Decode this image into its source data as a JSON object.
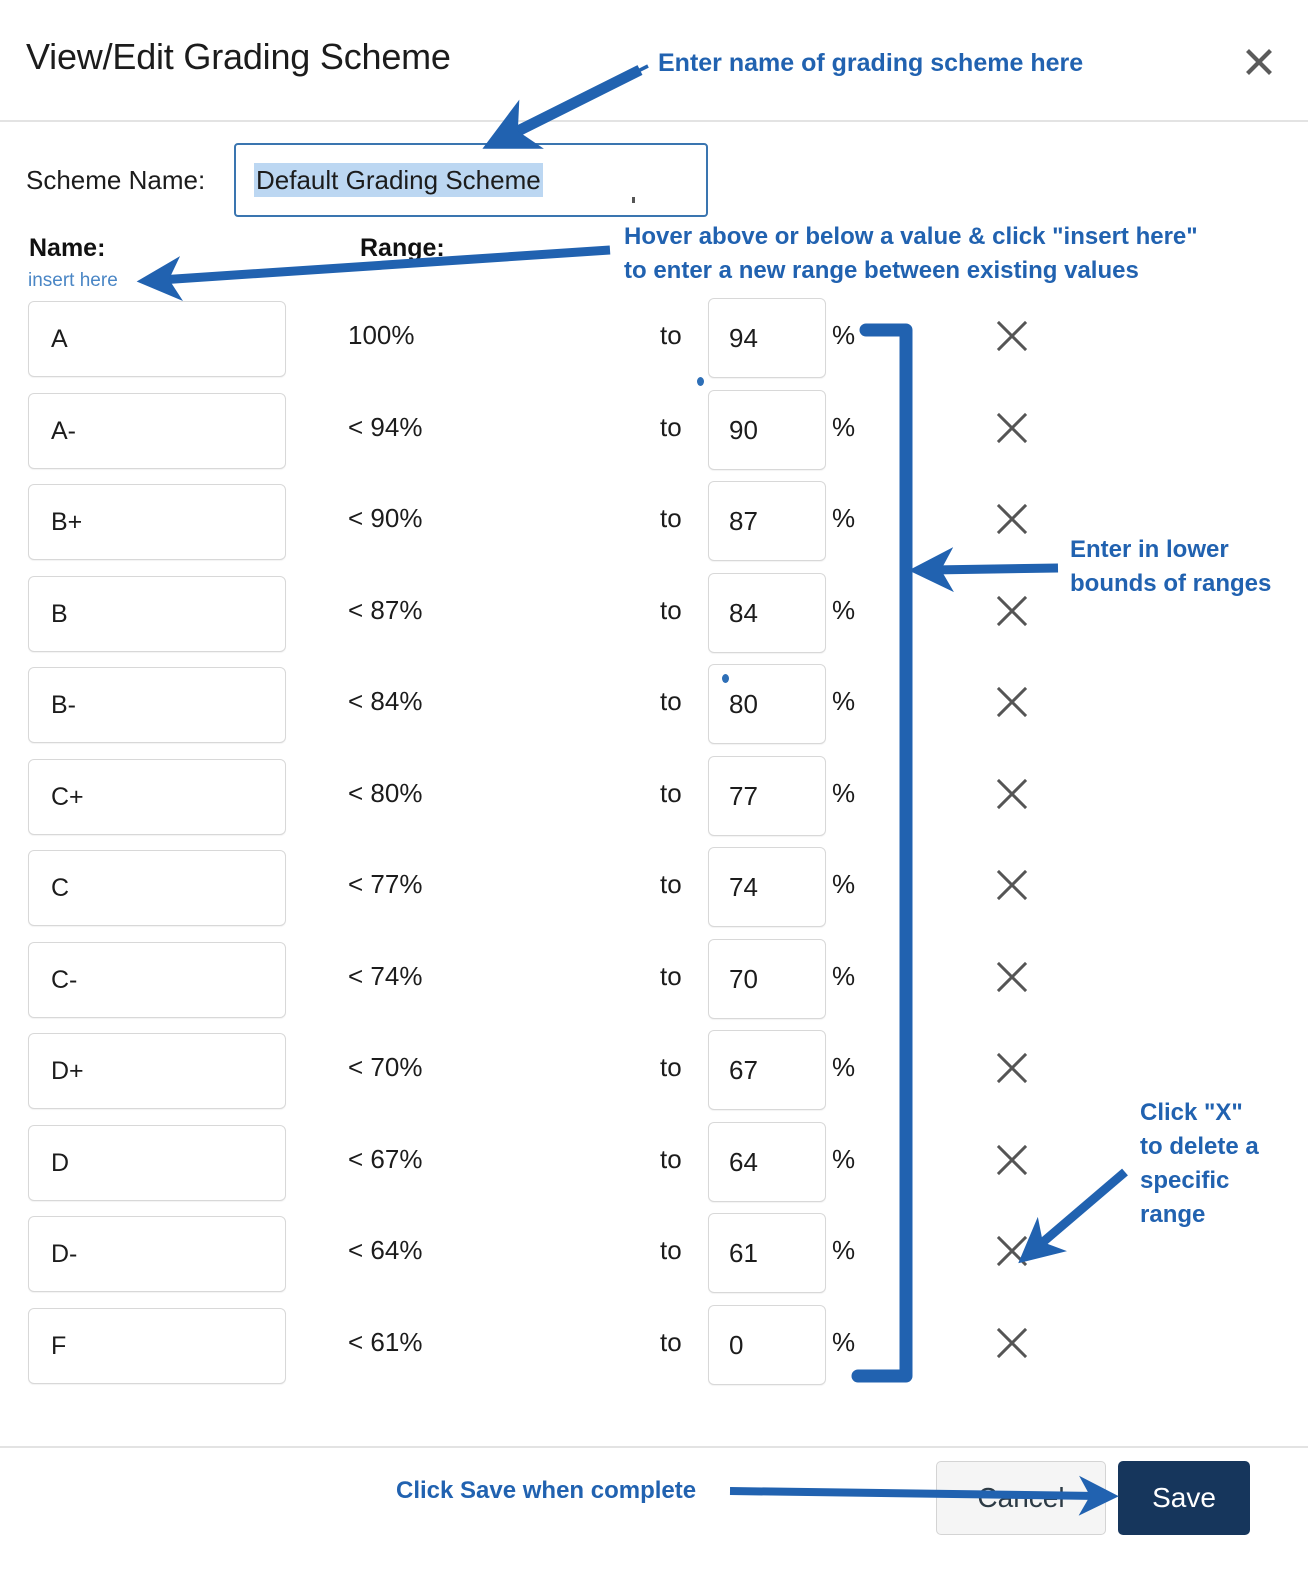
{
  "dialog": {
    "title": "View/Edit Grading Scheme",
    "close_icon": "close-icon"
  },
  "scheme_name": {
    "label": "Scheme Name:",
    "value": "Default Grading Scheme",
    "placeholder": "Scheme name"
  },
  "columns": {
    "name_header": "Name:",
    "range_header": "Range:",
    "insert_here": "insert here",
    "to_label": "to",
    "percent_sign": "%"
  },
  "rows": [
    {
      "name": "A",
      "upper": "100%",
      "to": "to",
      "lower": "94",
      "pct": "%",
      "delete_icon": "close-icon"
    },
    {
      "name": "A-",
      "upper": "< 94%",
      "to": "to",
      "lower": "90",
      "pct": "%",
      "delete_icon": "close-icon"
    },
    {
      "name": "B+",
      "upper": "< 90%",
      "to": "to",
      "lower": "87",
      "pct": "%",
      "delete_icon": "close-icon"
    },
    {
      "name": "B",
      "upper": "< 87%",
      "to": "to",
      "lower": "84",
      "pct": "%",
      "delete_icon": "close-icon"
    },
    {
      "name": "B-",
      "upper": "< 84%",
      "to": "to",
      "lower": "80",
      "pct": "%",
      "delete_icon": "close-icon"
    },
    {
      "name": "C+",
      "upper": "< 80%",
      "to": "to",
      "lower": "77",
      "pct": "%",
      "delete_icon": "close-icon"
    },
    {
      "name": "C",
      "upper": "< 77%",
      "to": "to",
      "lower": "74",
      "pct": "%",
      "delete_icon": "close-icon"
    },
    {
      "name": "C-",
      "upper": "< 74%",
      "to": "to",
      "lower": "70",
      "pct": "%",
      "delete_icon": "close-icon"
    },
    {
      "name": "D+",
      "upper": "< 70%",
      "to": "to",
      "lower": "67",
      "pct": "%",
      "delete_icon": "close-icon"
    },
    {
      "name": "D",
      "upper": "< 67%",
      "to": "to",
      "lower": "64",
      "pct": "%",
      "delete_icon": "close-icon"
    },
    {
      "name": "D-",
      "upper": "< 64%",
      "to": "to",
      "lower": "61",
      "pct": "%",
      "delete_icon": "close-icon"
    },
    {
      "name": "F",
      "upper": "< 61%",
      "to": "to",
      "lower": "0",
      "pct": "%",
      "delete_icon": "close-icon"
    }
  ],
  "footer": {
    "cancel_label": "Cancel",
    "save_label": "Save"
  },
  "annotations": {
    "scheme_name": "Enter name of grading scheme here",
    "insert_here": "Hover above or below a value & click \"insert here\"\nto enter a new range between existing values",
    "lower_bounds": "Enter in lower\nbounds of ranges",
    "delete_range": "Click \"X\"\nto delete a\nspecific\nrange",
    "save": "Click Save when complete"
  },
  "colors": {
    "annotation_blue": "#2162b0",
    "save_navy": "#16365c",
    "field_focus_blue": "#3a75b0",
    "selection_blue": "#bcd7f2",
    "link_blue": "#4a86c5"
  }
}
